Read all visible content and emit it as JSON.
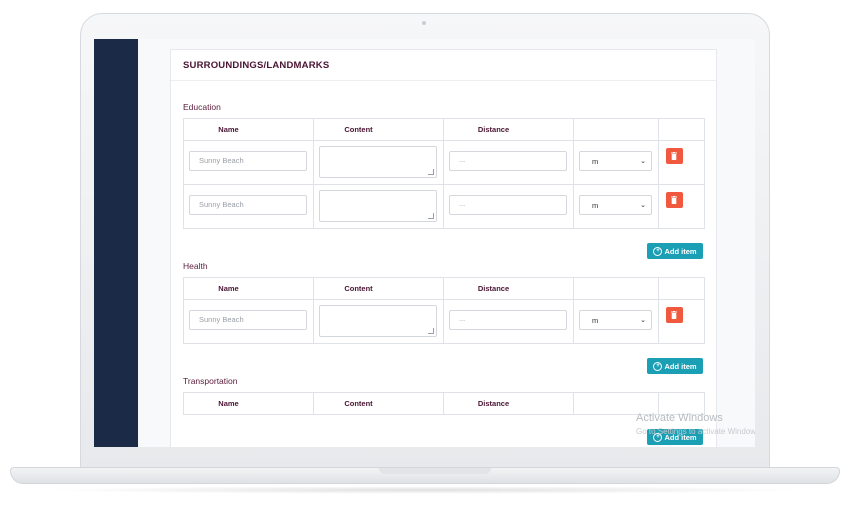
{
  "card": {
    "title": "SURROUNDINGS/LANDMARKS"
  },
  "columns": {
    "name": "Name",
    "content": "Content",
    "distance": "Distance"
  },
  "sections": [
    {
      "label": "Education",
      "rows": [
        {
          "name_placeholder": "Sunny Beach",
          "distance_placeholder": "...",
          "unit": "m"
        },
        {
          "name_placeholder": "Sunny Beach",
          "distance_placeholder": "...",
          "unit": "m"
        }
      ],
      "add_label": "Add item"
    },
    {
      "label": "Health",
      "rows": [
        {
          "name_placeholder": "Sunny Beach",
          "distance_placeholder": "...",
          "unit": "m"
        }
      ],
      "add_label": "Add item"
    },
    {
      "label": "Transportation",
      "rows": [],
      "add_label": "Add item"
    }
  ],
  "watermark": {
    "title": "Activate Windows",
    "subtitle": "Go to Settings to activate Windows."
  },
  "colors": {
    "sidebar": "#1b2a47",
    "accent": "#1a9fb5",
    "danger": "#f0593e",
    "heading": "#4a1433"
  }
}
